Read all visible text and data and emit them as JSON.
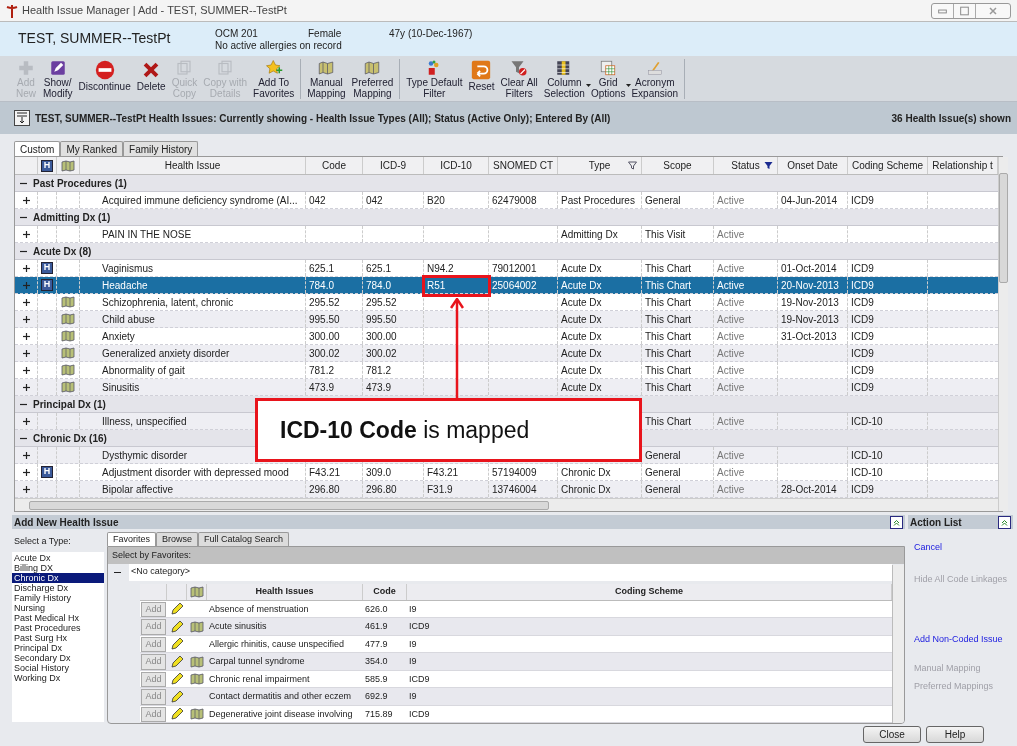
{
  "window": {
    "title": "Health Issue Manager | Add - TEST, SUMMER--TestPt"
  },
  "patient": {
    "name": "TEST, SUMMER--TestPt",
    "id": "OCM 201",
    "allergies": "No active allergies on record",
    "sex": "Female",
    "age": "47y (10-Dec-1967)"
  },
  "toolbar": [
    [
      {
        "lines": [
          "Add",
          "New"
        ],
        "enabled": false
      },
      {
        "lines": [
          "Show/",
          "Modify"
        ],
        "enabled": true
      },
      {
        "lines": [
          "Discontinue"
        ],
        "enabled": true
      },
      {
        "lines": [
          "Delete"
        ],
        "enabled": true
      },
      {
        "lines": [
          "Quick",
          "Copy"
        ],
        "enabled": false
      },
      {
        "lines": [
          "Copy with",
          "Details"
        ],
        "enabled": false
      },
      {
        "lines": [
          "Add To",
          "Favorites"
        ],
        "enabled": true
      }
    ],
    [
      {
        "lines": [
          "Manual",
          "Mapping"
        ],
        "enabled": true
      },
      {
        "lines": [
          "Preferred",
          "Mapping"
        ],
        "enabled": true
      }
    ],
    [
      {
        "lines": [
          "Type Default",
          "Filter"
        ],
        "enabled": true
      },
      {
        "lines": [
          "Reset"
        ],
        "enabled": true
      },
      {
        "lines": [
          "Clear All",
          "Filters"
        ],
        "enabled": true
      },
      {
        "lines": [
          "Column",
          "Selection"
        ],
        "enabled": true,
        "dropdown": true
      },
      {
        "lines": [
          "Grid",
          "Options"
        ],
        "enabled": true,
        "dropdown": true
      },
      {
        "lines": [
          "Acronym",
          "Expansion"
        ],
        "enabled": true
      }
    ]
  ],
  "info_bar": {
    "text": "TEST, SUMMER--TestPt Health Issues: Currently showing - Health Issue Types (All); Status (Active Only); Entered By (All)",
    "count": "36 Health Issue(s) shown"
  },
  "tabs": [
    {
      "label": "Custom",
      "selected": true
    },
    {
      "label": "My Ranked",
      "selected": false
    },
    {
      "label": "Family History",
      "selected": false
    }
  ],
  "grid": {
    "header_marker": "H",
    "columns": [
      {
        "label": "Health Issue",
        "filter": false
      },
      {
        "label": "Code",
        "filter": false
      },
      {
        "label": "ICD-9",
        "filter": false
      },
      {
        "label": "ICD-10",
        "filter": false
      },
      {
        "label": "SNOMED CT",
        "filter": false
      },
      {
        "label": "Type",
        "filter": true,
        "filter_active": false
      },
      {
        "label": "Scope",
        "filter": false
      },
      {
        "label": "Status",
        "filter": true,
        "filter_active": true
      },
      {
        "label": "Onset Date",
        "filter": false
      },
      {
        "label": "Coding Scheme",
        "filter": false
      },
      {
        "label": "Relationship t",
        "filter": false
      }
    ],
    "groups": [
      {
        "label": "Past Procedures (1)",
        "expanded": true,
        "items": [
          {
            "expanded": false,
            "selected": false,
            "mapped": false,
            "issue": "Acquired immune deficiency syndrome (AI...",
            "code": "042",
            "icd9": "042",
            "icd10": "B20",
            "snomed": "62479008",
            "type": "Past Procedures",
            "scope": "General",
            "status": "Active",
            "onset": "04-Jun-2014",
            "scheme": "ICD9"
          }
        ]
      },
      {
        "label": "Admitting Dx (1)",
        "expanded": true,
        "items": [
          {
            "expanded": false,
            "selected": false,
            "mapped": false,
            "issue": "PAIN IN THE NOSE",
            "type": "Admitting Dx",
            "scope": "This Visit",
            "status": "Active"
          }
        ]
      },
      {
        "label": "Acute Dx (8)",
        "expanded": true,
        "items": [
          {
            "expanded": false,
            "selected": false,
            "marker": "H",
            "mapped": false,
            "issue": "Vaginismus",
            "code": "625.1",
            "icd9": "625.1",
            "icd10": "N94.2",
            "snomed": "79012001",
            "type": "Acute Dx",
            "scope": "This Chart",
            "status": "Active",
            "onset": "01-Oct-2014",
            "scheme": "ICD9"
          },
          {
            "expanded": false,
            "selected": true,
            "marker": "H",
            "mapped": false,
            "issue": "Headache",
            "code": "784.0",
            "icd9": "784.0",
            "icd10": "R51",
            "snomed": "25064002",
            "type": "Acute Dx",
            "scope": "This Chart",
            "status": "Active",
            "onset": "20-Nov-2013",
            "scheme": "ICD9"
          },
          {
            "expanded": false,
            "selected": false,
            "mapped": true,
            "issue": "Schizophrenia, latent, chronic",
            "code": "295.52",
            "icd9": "295.52",
            "type": "Acute Dx",
            "scope": "This Chart",
            "status": "Active",
            "onset": "19-Nov-2013",
            "scheme": "ICD9"
          },
          {
            "expanded": false,
            "selected": false,
            "mapped": true,
            "issue": "Child abuse",
            "code": "995.50",
            "icd9": "995.50",
            "type": "Acute Dx",
            "scope": "This Chart",
            "status": "Active",
            "onset": "19-Nov-2013",
            "scheme": "ICD9"
          },
          {
            "expanded": false,
            "selected": false,
            "mapped": true,
            "issue": "Anxiety",
            "code": "300.00",
            "icd9": "300.00",
            "type": "Acute Dx",
            "scope": "This Chart",
            "status": "Active",
            "onset": "31-Oct-2013",
            "scheme": "ICD9"
          },
          {
            "expanded": false,
            "selected": false,
            "mapped": true,
            "issue": "Generalized anxiety disorder",
            "code": "300.02",
            "icd9": "300.02",
            "type": "Acute Dx",
            "scope": "This Chart",
            "status": "Active",
            "scheme": "ICD9"
          },
          {
            "expanded": false,
            "selected": false,
            "mapped": true,
            "issue": "Abnormality of gait",
            "code": "781.2",
            "icd9": "781.2",
            "type": "Acute Dx",
            "scope": "This Chart",
            "status": "Active",
            "scheme": "ICD9"
          },
          {
            "expanded": false,
            "selected": false,
            "mapped": true,
            "issue": "Sinusitis",
            "code": "473.9",
            "icd9": "473.9",
            "type": "Acute Dx",
            "scope": "This Chart",
            "status": "Active",
            "scheme": "ICD9"
          }
        ]
      },
      {
        "label": "Principal Dx (1)",
        "expanded": true,
        "items": [
          {
            "expanded": false,
            "selected": false,
            "mapped": false,
            "issue": "Illness, unspecified",
            "scope": "This Chart",
            "status": "Active",
            "scheme": "ICD-10"
          }
        ]
      },
      {
        "label": "Chronic Dx (16)",
        "expanded": true,
        "items": [
          {
            "expanded": false,
            "selected": false,
            "mapped": false,
            "issue": "Dysthymic disorder",
            "scope": "General",
            "status": "Active",
            "scheme": "ICD-10"
          },
          {
            "expanded": false,
            "selected": false,
            "marker": "H",
            "mapped": false,
            "issue": "Adjustment disorder with depressed mood",
            "code": "F43.21",
            "icd9": "309.0",
            "icd10": "F43.21",
            "snomed": "57194009",
            "type": "Chronic Dx",
            "scope": "General",
            "status": "Active",
            "scheme": "ICD-10"
          },
          {
            "expanded": false,
            "selected": false,
            "mapped": false,
            "issue": "Bipolar affective",
            "code": "296.80",
            "icd9": "296.80",
            "icd10": "F31.9",
            "snomed": "13746004",
            "type": "Chronic Dx",
            "scope": "General",
            "status": "Active",
            "onset": "28-Oct-2014",
            "scheme": "ICD9"
          }
        ]
      }
    ]
  },
  "callout": {
    "text": "**ICD-10 Code** is mapped"
  },
  "add_panel": {
    "title": "Add New Health Issue",
    "type_label": "Select a Type:",
    "types": [
      {
        "label": "Acute Dx",
        "selected": false
      },
      {
        "label": "Billing DX",
        "selected": false
      },
      {
        "label": "Chronic Dx",
        "selected": true
      },
      {
        "label": "Discharge Dx",
        "selected": false
      },
      {
        "label": "Family History",
        "selected": false
      },
      {
        "label": "Nursing",
        "selected": false
      },
      {
        "label": "Past Medical Hx",
        "selected": false
      },
      {
        "label": "Past Procedures",
        "selected": false
      },
      {
        "label": "Past Surg Hx",
        "selected": false
      },
      {
        "label": "Principal Dx",
        "selected": false
      },
      {
        "label": "Secondary Dx",
        "selected": false
      },
      {
        "label": "Social History",
        "selected": false
      },
      {
        "label": "Working Dx",
        "selected": false
      }
    ],
    "tabs": [
      {
        "label": "Favorites",
        "selected": true
      },
      {
        "label": "Browse",
        "selected": false
      },
      {
        "label": "Full Catalog Search",
        "selected": false
      }
    ],
    "section": "Select by Favorites:",
    "category": {
      "label": "<No category>",
      "expanded": true
    },
    "columns": [
      "Health Issues",
      "Code",
      "Coding Scheme"
    ],
    "rows": [
      {
        "add": "Add",
        "mapped": false,
        "issue": "Absence of menstruation",
        "code": "626.0",
        "scheme": "I9"
      },
      {
        "add": "Add",
        "mapped": true,
        "issue": "Acute sinusitis",
        "code": "461.9",
        "scheme": "ICD9"
      },
      {
        "add": "Add",
        "mapped": false,
        "issue": "Allergic rhinitis, cause unspecified",
        "code": "477.9",
        "scheme": "I9"
      },
      {
        "add": "Add",
        "mapped": true,
        "issue": "Carpal tunnel syndrome",
        "code": "354.0",
        "scheme": "I9"
      },
      {
        "add": "Add",
        "mapped": true,
        "issue": "Chronic renal impairment",
        "code": "585.9",
        "scheme": "ICD9"
      },
      {
        "add": "Add",
        "mapped": false,
        "issue": "Contact dermatitis and other eczem",
        "code": "692.9",
        "scheme": "I9"
      },
      {
        "add": "Add",
        "mapped": true,
        "issue": "Degenerative joint disease involving",
        "code": "715.89",
        "scheme": "ICD9"
      }
    ]
  },
  "action_list": {
    "title": "Action List",
    "items": [
      {
        "label": "Cancel",
        "enabled": true
      },
      {
        "label": "Hide All Code Linkages",
        "enabled": false
      },
      {
        "label": "Add Non-Coded Issue",
        "enabled": true
      },
      {
        "label": "Manual Mapping",
        "enabled": false
      },
      {
        "label": "Preferred Mappings",
        "enabled": false
      }
    ]
  },
  "buttons": [
    "Close",
    "Help"
  ]
}
